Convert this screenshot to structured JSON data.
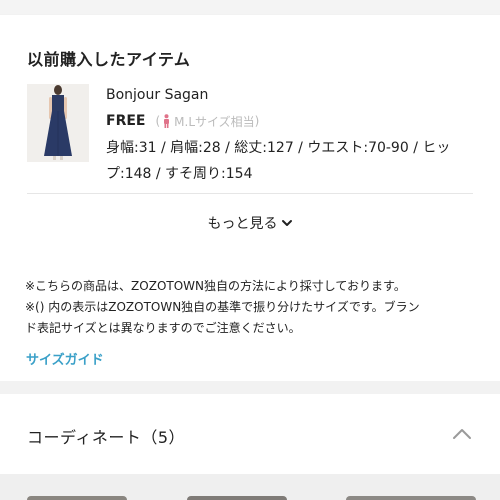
{
  "purchased_items": {
    "title": "以前購入したアイテム",
    "item": {
      "brand": "Bonjour Sagan",
      "size": "FREE",
      "size_equivalent": "M.Lサイズ相当",
      "measurements": "身幅:31 / 肩幅:28 / 総丈:127 / ウエスト:70-90 / ヒップ:148 / すそ周り:154"
    },
    "more_label": "もっと見る",
    "notes": [
      "※こちらの商品は、ZOZOTOWN独自の方法により採寸しております。",
      "※() 内の表示はZOZOTOWN独自の基準で振り分けたサイズです。ブラン",
      "ド表記サイズとは異なりますのでご注意ください。"
    ],
    "size_guide_label": "サイズガイド"
  },
  "coordinate": {
    "title": "コーディネート（5）"
  },
  "colors": {
    "link": "#3aa0c8",
    "size_icon": "#e0738a"
  }
}
